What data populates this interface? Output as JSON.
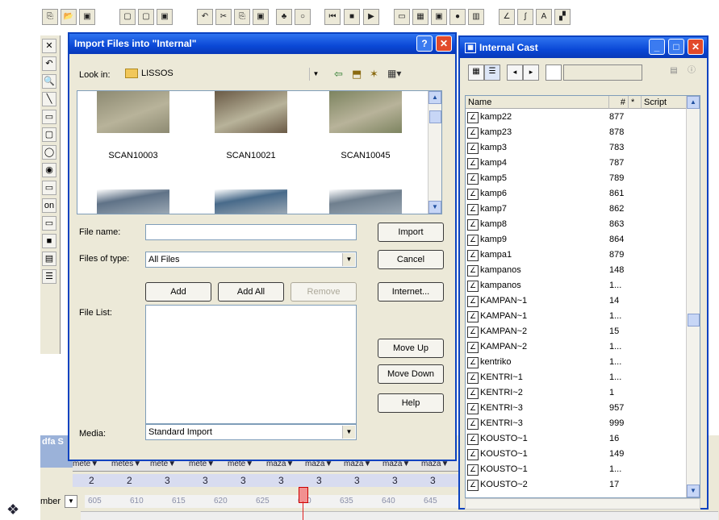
{
  "toolbar": {
    "icons": [
      "paste-icon",
      "open-icon",
      "save-icon",
      "save-all-icon",
      "import-icon",
      "undo-icon",
      "cut-icon",
      "copy-icon",
      "paste-icon",
      "find-icon",
      "rewind-icon",
      "stop-icon",
      "play-icon",
      "stage-icon",
      "cast-icon",
      "score-icon",
      "info-icon",
      "library-icon",
      "paint-icon",
      "vector-icon",
      "text-icon",
      "script-icon",
      "behavior-icon",
      "message-icon"
    ]
  },
  "tools": {
    "labels": [
      "✕",
      "↶",
      "🔍",
      "╲",
      "▭",
      "▢",
      "◯",
      "◉",
      "▭",
      "on",
      "▭",
      "■",
      "▤",
      "☰"
    ]
  },
  "dialog": {
    "title": "Import Files into \"Internal\"",
    "help_label": "?",
    "close_label": "✕",
    "look_in_label": "Look in:",
    "look_in_value": "LISSOS",
    "thumbnails": [
      {
        "name": "SCAN10003",
        "color": "#8d8a72"
      },
      {
        "name": "SCAN10021",
        "color": "#6a5a46"
      },
      {
        "name": "SCAN10045",
        "color": "#7d8460"
      }
    ],
    "thumbnails_row2_colors": [
      "#5f7287",
      "#486a8a",
      "#6f7f8e"
    ],
    "file_name_label": "File name:",
    "file_name_value": "",
    "files_of_type_label": "Files of type:",
    "files_of_type_value": "All Files",
    "file_list_label": "File List:",
    "media_label": "Media:",
    "media_value": "Standard Import",
    "buttons": {
      "import": "Import",
      "cancel": "Cancel",
      "internet": "Internet...",
      "add": "Add",
      "add_all": "Add All",
      "remove": "Remove",
      "move_up": "Move Up",
      "move_down": "Move Down",
      "help": "Help"
    }
  },
  "cast": {
    "title": "Internal Cast",
    "columns": {
      "name": "Name",
      "number": "#",
      "star": "*",
      "script": "Script"
    },
    "rows": [
      {
        "name": "kamp22",
        "num": "877"
      },
      {
        "name": "kamp23",
        "num": "878"
      },
      {
        "name": "kamp3",
        "num": "783"
      },
      {
        "name": "kamp4",
        "num": "787"
      },
      {
        "name": "kamp5",
        "num": "789"
      },
      {
        "name": "kamp6",
        "num": "861"
      },
      {
        "name": "kamp7",
        "num": "862"
      },
      {
        "name": "kamp8",
        "num": "863"
      },
      {
        "name": "kamp9",
        "num": "864"
      },
      {
        "name": "kampa1",
        "num": "879"
      },
      {
        "name": "kampanos",
        "num": "148"
      },
      {
        "name": "kampanos",
        "num": "1..."
      },
      {
        "name": "KAMPAN~1",
        "num": "14"
      },
      {
        "name": "KAMPAN~1",
        "num": "1..."
      },
      {
        "name": "KAMPAN~2",
        "num": "15"
      },
      {
        "name": "KAMPAN~2",
        "num": "1..."
      },
      {
        "name": "kentriko",
        "num": "1..."
      },
      {
        "name": "KENTRI~1",
        "num": "1..."
      },
      {
        "name": "KENTRI~2",
        "num": "1"
      },
      {
        "name": "KENTRI~3",
        "num": "957"
      },
      {
        "name": "KENTRI~3",
        "num": "999"
      },
      {
        "name": "KOUSTO~1",
        "num": "16"
      },
      {
        "name": "KOUSTO~1",
        "num": "149"
      },
      {
        "name": "KOUSTO~1",
        "num": "1..."
      },
      {
        "name": "KOUSTO~2",
        "num": "17"
      }
    ]
  },
  "score": {
    "channel_label": "mber",
    "side_label": "dfa S",
    "sprite_labels": [
      "mete",
      "metes",
      "mete",
      "mete",
      "mete",
      "maza",
      "maza",
      "maza",
      "maza",
      "maza",
      "maz"
    ],
    "frame_counts": [
      "2",
      "2",
      "3",
      "3",
      "3",
      "3",
      "3",
      "3",
      "3",
      "3"
    ],
    "frame_numbers": [
      "605",
      "610",
      "615",
      "620",
      "625",
      "630",
      "635",
      "640",
      "645",
      "650"
    ]
  },
  "colors": {
    "titlebar": "#0a48d6",
    "dialog_bg": "#ece9d8",
    "close_red": "#e24a2b",
    "playhead": "#e02020"
  }
}
